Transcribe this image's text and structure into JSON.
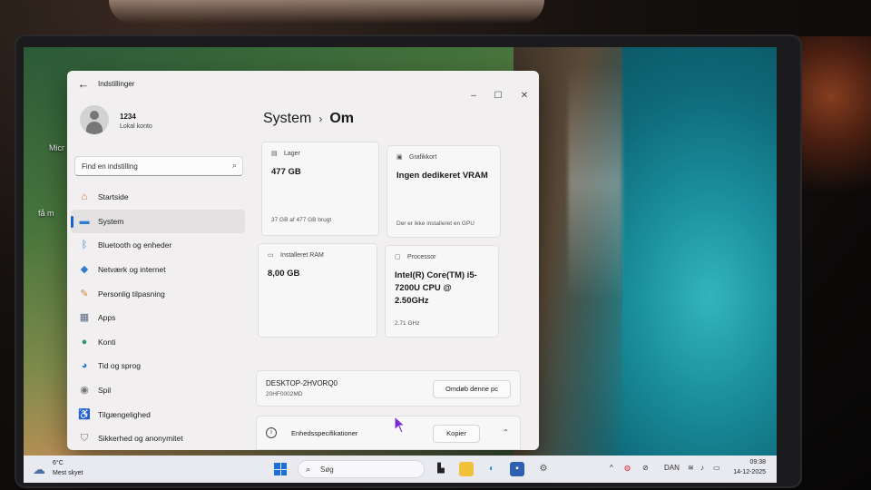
{
  "desktop": {
    "icon_label_1": "Micr",
    "icon_label_2": "få m"
  },
  "window": {
    "title": "Indstillinger",
    "controls": [
      "–",
      "☐",
      "✕"
    ]
  },
  "user": {
    "name": "1234",
    "account_type": "Lokal konto"
  },
  "search": {
    "placeholder": "Find en indstilling"
  },
  "nav": {
    "items": [
      {
        "label": "Startside",
        "icon": "home-icon"
      },
      {
        "label": "System",
        "icon": "monitor-icon",
        "active": true
      },
      {
        "label": "Bluetooth og enheder",
        "icon": "bluetooth-icon"
      },
      {
        "label": "Netværk og internet",
        "icon": "wifi-icon"
      },
      {
        "label": "Personlig tilpasning",
        "icon": "brush-icon"
      },
      {
        "label": "Apps",
        "icon": "apps-icon"
      },
      {
        "label": "Konti",
        "icon": "account-icon"
      },
      {
        "label": "Tid og sprog",
        "icon": "globe-clock-icon"
      },
      {
        "label": "Spil",
        "icon": "gamepad-icon"
      },
      {
        "label": "Tilgængelighed",
        "icon": "accessibility-icon"
      },
      {
        "label": "Sikkerhed og anonymitet",
        "icon": "shield-icon"
      }
    ]
  },
  "breadcrumb": {
    "parent": "System",
    "separator": "›",
    "current": "Om"
  },
  "cards": {
    "storage": {
      "title": "Lager",
      "value": "477 GB",
      "footer": "37 GB af 477 GB brugt"
    },
    "graphics": {
      "title": "Grafikkort",
      "value": "Ingen dedikeret VRAM",
      "footer": "Der er ikke installeret en GPU"
    },
    "ram": {
      "title": "Installeret RAM",
      "value": "8,00 GB"
    },
    "processor": {
      "title": "Processor",
      "value": "Intel(R) Core(TM) i5-7200U CPU @ 2.50GHz",
      "footer": "2.71 GHz"
    }
  },
  "device": {
    "name": "DESKTOP-2HVORQ0",
    "model": "20HF0002MD",
    "rename_label": "Omdøb denne pc"
  },
  "specs": {
    "label": "Enhedsspecifikationer",
    "copy_label": "Kopier"
  },
  "taskbar": {
    "temperature": "6°C",
    "weather": "Mest skyet",
    "search_placeholder": "Søg",
    "language": "DAN",
    "time": "09:38",
    "date": "14-12-2025"
  },
  "colors": {
    "accent": "#1a63c6",
    "window_bg": "#f1eff0",
    "card_bg": "#f8f7f8",
    "taskbar_bg": "#e9eaf0"
  }
}
